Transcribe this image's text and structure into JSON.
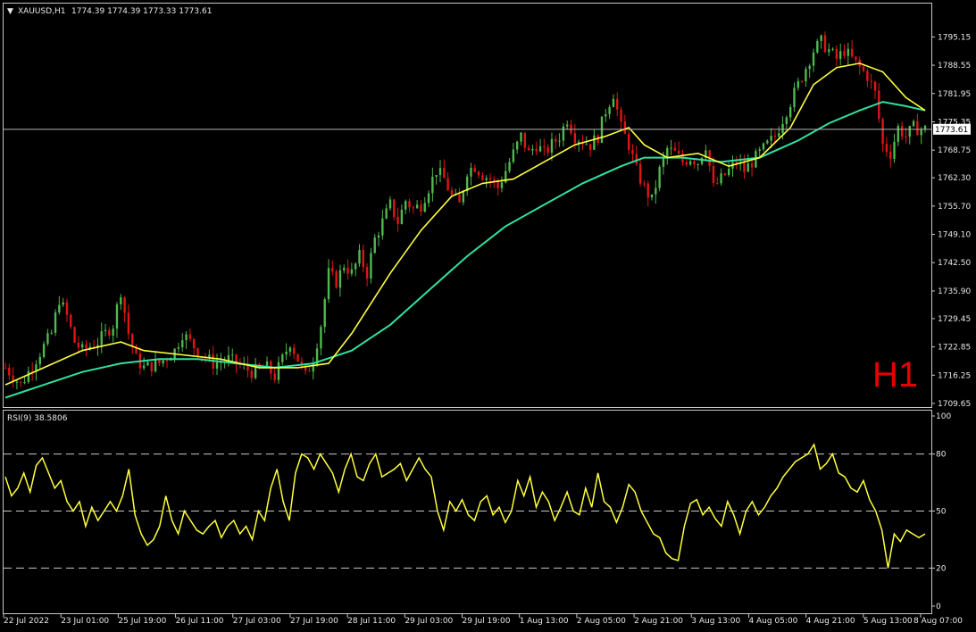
{
  "header": {
    "symbol": "XAUUSD,H1",
    "ohlc": "1774.39 1774.39 1773.33 1773.61",
    "timeframe_watermark": "H1"
  },
  "colors": {
    "background": "#000000",
    "axis_text": "#e8e8e8",
    "frame": "#c8c8c8",
    "bull_candle": "#4fb84f",
    "bear_candle": "#e01515",
    "ma_fast": "#ffff3c",
    "ma_slow": "#30e0a0",
    "rsi_line": "#ffff3c",
    "price_line": "#b4b4b4",
    "watermark": "#e60000"
  },
  "chart_data": [
    {
      "type": "candlestick",
      "title": "XAUUSD,H1",
      "ylim": [
        1709.65,
        1798.35
      ],
      "y_ticks": [
        "1795.15",
        "1788.55",
        "1781.95",
        "1775.35",
        "1768.75",
        "1762.30",
        "1755.70",
        "1749.10",
        "1742.50",
        "1735.90",
        "1729.45",
        "1722.85",
        "1716.25",
        "1709.65"
      ],
      "current_price": "1773.61",
      "x_ticks": [
        "22 Jul 2022",
        "23 Jul 01:00",
        "25 Jul 19:00",
        "26 Jul 11:00",
        "27 Jul 03:00",
        "27 Jul 19:00",
        "28 Jul 11:00",
        "29 Jul 03:00",
        "29 Jul 19:00",
        "1 Aug 13:00",
        "2 Aug 05:00",
        "2 Aug 21:00",
        "3 Aug 13:00",
        "4 Aug 05:00",
        "4 Aug 21:00",
        "5 Aug 13:00",
        "8 Aug 07:00"
      ],
      "close_path": [
        [
          0,
          1718
        ],
        [
          4,
          1714
        ],
        [
          8,
          1720
        ],
        [
          12,
          1726
        ],
        [
          14,
          1734
        ],
        [
          16,
          1730
        ],
        [
          18,
          1724
        ],
        [
          20,
          1722
        ],
        [
          24,
          1724
        ],
        [
          28,
          1728
        ],
        [
          30,
          1736
        ],
        [
          32,
          1726
        ],
        [
          34,
          1720
        ],
        [
          36,
          1718
        ],
        [
          40,
          1719
        ],
        [
          44,
          1722
        ],
        [
          46,
          1726
        ],
        [
          48,
          1724
        ],
        [
          50,
          1722
        ],
        [
          54,
          1719
        ],
        [
          58,
          1720
        ],
        [
          62,
          1718
        ],
        [
          64,
          1717
        ],
        [
          68,
          1718
        ],
        [
          70,
          1716
        ],
        [
          72,
          1720
        ],
        [
          74,
          1724
        ],
        [
          76,
          1720
        ],
        [
          78,
          1716
        ],
        [
          80,
          1720
        ],
        [
          82,
          1728
        ],
        [
          84,
          1740
        ],
        [
          86,
          1738
        ],
        [
          88,
          1742
        ],
        [
          90,
          1740
        ],
        [
          92,
          1744
        ],
        [
          94,
          1740
        ],
        [
          96,
          1748
        ],
        [
          98,
          1752
        ],
        [
          100,
          1756
        ],
        [
          102,
          1752
        ],
        [
          104,
          1757
        ],
        [
          106,
          1755
        ],
        [
          108,
          1756
        ],
        [
          110,
          1760
        ],
        [
          112,
          1764
        ],
        [
          114,
          1762
        ],
        [
          116,
          1758
        ],
        [
          118,
          1756
        ],
        [
          120,
          1764
        ],
        [
          122,
          1765
        ],
        [
          124,
          1763
        ],
        [
          126,
          1762
        ],
        [
          128,
          1760
        ],
        [
          130,
          1764
        ],
        [
          132,
          1768
        ],
        [
          134,
          1772
        ],
        [
          136,
          1768
        ],
        [
          138,
          1770
        ],
        [
          140,
          1768
        ],
        [
          142,
          1770
        ],
        [
          144,
          1772
        ],
        [
          146,
          1776
        ],
        [
          148,
          1772
        ],
        [
          150,
          1771
        ],
        [
          152,
          1770
        ],
        [
          154,
          1772
        ],
        [
          156,
          1778
        ],
        [
          158,
          1782
        ],
        [
          160,
          1774
        ],
        [
          162,
          1770
        ],
        [
          164,
          1764
        ],
        [
          166,
          1760
        ],
        [
          168,
          1757
        ],
        [
          170,
          1764
        ],
        [
          172,
          1769
        ],
        [
          174,
          1768
        ],
        [
          176,
          1766
        ],
        [
          178,
          1767
        ],
        [
          180,
          1766
        ],
        [
          182,
          1770
        ],
        [
          184,
          1760
        ],
        [
          186,
          1762
        ],
        [
          188,
          1764
        ],
        [
          190,
          1766
        ],
        [
          192,
          1764
        ],
        [
          194,
          1766
        ],
        [
          196,
          1768
        ],
        [
          198,
          1770
        ],
        [
          200,
          1772
        ],
        [
          202,
          1776
        ],
        [
          204,
          1780
        ],
        [
          206,
          1784
        ],
        [
          208,
          1788
        ],
        [
          210,
          1792
        ],
        [
          212,
          1794
        ],
        [
          214,
          1792
        ],
        [
          216,
          1790
        ],
        [
          218,
          1792
        ],
        [
          220,
          1790
        ],
        [
          222,
          1788
        ],
        [
          224,
          1786
        ],
        [
          226,
          1782
        ],
        [
          228,
          1770
        ],
        [
          230,
          1768
        ],
        [
          232,
          1774
        ],
        [
          234,
          1772
        ],
        [
          236,
          1774
        ],
        [
          238,
          1773.61
        ]
      ],
      "ma_fast_path": [
        [
          0,
          1714
        ],
        [
          10,
          1718
        ],
        [
          20,
          1722
        ],
        [
          30,
          1724
        ],
        [
          36,
          1722
        ],
        [
          46,
          1721
        ],
        [
          56,
          1720
        ],
        [
          66,
          1718
        ],
        [
          76,
          1718
        ],
        [
          84,
          1719
        ],
        [
          90,
          1726
        ],
        [
          100,
          1740
        ],
        [
          108,
          1750
        ],
        [
          116,
          1758
        ],
        [
          124,
          1761
        ],
        [
          132,
          1762
        ],
        [
          140,
          1766
        ],
        [
          148,
          1770
        ],
        [
          156,
          1772
        ],
        [
          162,
          1774
        ],
        [
          166,
          1770
        ],
        [
          172,
          1767
        ],
        [
          180,
          1768
        ],
        [
          188,
          1765
        ],
        [
          196,
          1767
        ],
        [
          204,
          1774
        ],
        [
          210,
          1784
        ],
        [
          216,
          1788
        ],
        [
          222,
          1789
        ],
        [
          228,
          1787
        ],
        [
          234,
          1781
        ],
        [
          239,
          1778
        ]
      ],
      "ma_slow_path": [
        [
          0,
          1711
        ],
        [
          10,
          1714
        ],
        [
          20,
          1717
        ],
        [
          30,
          1719
        ],
        [
          40,
          1720
        ],
        [
          50,
          1720
        ],
        [
          60,
          1719
        ],
        [
          70,
          1718
        ],
        [
          80,
          1719
        ],
        [
          90,
          1722
        ],
        [
          100,
          1728
        ],
        [
          110,
          1736
        ],
        [
          120,
          1744
        ],
        [
          130,
          1751
        ],
        [
          140,
          1756
        ],
        [
          150,
          1761
        ],
        [
          160,
          1765
        ],
        [
          166,
          1767
        ],
        [
          176,
          1767
        ],
        [
          186,
          1766
        ],
        [
          196,
          1767
        ],
        [
          206,
          1771
        ],
        [
          214,
          1775
        ],
        [
          222,
          1778
        ],
        [
          228,
          1780
        ],
        [
          234,
          1779
        ],
        [
          239,
          1778
        ]
      ]
    },
    {
      "type": "line",
      "title": "RSI(9) 38.5806",
      "ylim": [
        0,
        100
      ],
      "y_ticks": [
        "100",
        "80",
        "50",
        "20",
        "0"
      ],
      "levels": [
        80,
        50,
        20
      ],
      "series": [
        {
          "name": "RSI(9)",
          "values": [
            68,
            58,
            62,
            70,
            60,
            74,
            78,
            70,
            62,
            66,
            55,
            50,
            55,
            42,
            52,
            45,
            50,
            55,
            50,
            58,
            72,
            48,
            38,
            32,
            35,
            42,
            58,
            45,
            38,
            50,
            45,
            40,
            38,
            42,
            45,
            36,
            42,
            45,
            38,
            42,
            35,
            50,
            45,
            62,
            72,
            55,
            45,
            70,
            80,
            78,
            72,
            80,
            75,
            70,
            60,
            72,
            80,
            68,
            66,
            75,
            80,
            68,
            70,
            72,
            75,
            66,
            72,
            78,
            72,
            68,
            50,
            40,
            55,
            50,
            56,
            48,
            45,
            55,
            58,
            48,
            52,
            44,
            50,
            66,
            58,
            68,
            52,
            60,
            55,
            45,
            52,
            60,
            50,
            48,
            62,
            52,
            70,
            55,
            52,
            44,
            52,
            64,
            60,
            50,
            44,
            38,
            36,
            28,
            25,
            24,
            42,
            54,
            56,
            48,
            52,
            46,
            42,
            55,
            48,
            38,
            50,
            55,
            48,
            52,
            58,
            62,
            68,
            72,
            76,
            78,
            80,
            85,
            72,
            75,
            80,
            70,
            68,
            62,
            60,
            66,
            56,
            50,
            40,
            20,
            38,
            34,
            40,
            38,
            36,
            38
          ]
        }
      ]
    }
  ]
}
